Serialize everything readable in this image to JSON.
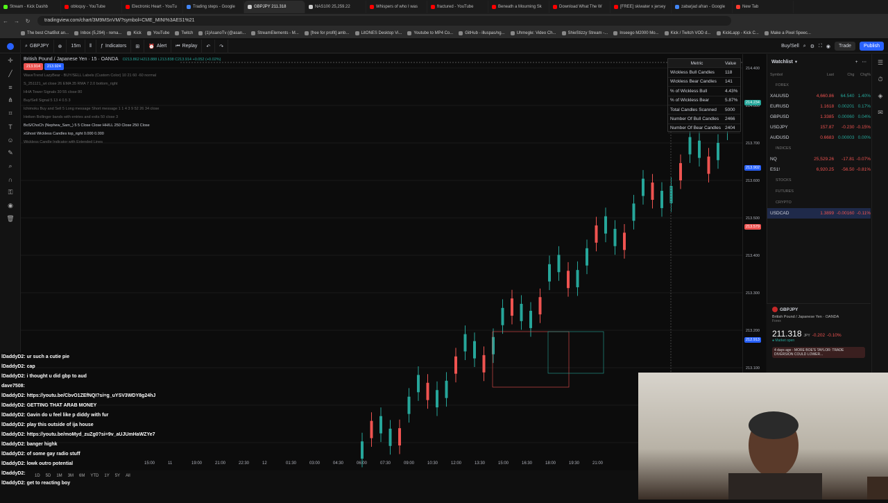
{
  "browser": {
    "tabs": [
      {
        "label": "Stream - Kick Dashb",
        "color": "#53fc18"
      },
      {
        "label": "obloquy - YouTube",
        "color": "#ff0000"
      },
      {
        "label": "Electronic Heart - YouTu",
        "color": "#ff0000"
      },
      {
        "label": "Trading steps - Google",
        "color": "#4285f4"
      },
      {
        "label": "GBPJPY 211.318",
        "color": "#cccccc"
      },
      {
        "label": "NAS100 25,259.22",
        "color": "#cccccc"
      },
      {
        "label": "Whispers of who I was",
        "color": "#ff0000"
      },
      {
        "label": "fractured - YouTube",
        "color": "#ff0000"
      },
      {
        "label": "Beneath a Mourning Sk",
        "color": "#ff0000"
      },
      {
        "label": "Download What The W",
        "color": "#ff0000"
      },
      {
        "label": "[FREE] skiwater x jersey",
        "color": "#ff0000"
      },
      {
        "label": "zabarjad afran - Google",
        "color": "#4285f4"
      },
      {
        "label": "New Tab",
        "color": "#ff3b30"
      }
    ],
    "url": "tradingview.com/chart/3M9MSnVM/?symbol=CME_MINI%3AES1%21",
    "bookmarks": [
      "The best ChatBot an...",
      "Inbox (5,294) - rema...",
      "Kick",
      "YouTube",
      "Twitch",
      "(1)AsanoTv (@asan...",
      "StreamElements - M...",
      "[free for profit] amb...",
      "LitONES Desktop Vi...",
      "Youtube to MP4 Co...",
      "GitHub - illuspas/ng...",
      "Uhmegle: Video Ch...",
      "ShieStizzy Stream -...",
      "Inseego M2000 Mo...",
      "Kick / Twitch VOD d...",
      "KickLapp - Kick C...",
      "Make a Pixel Speec..."
    ]
  },
  "toolbar": {
    "symbol": "GBPJPY",
    "interval": "15m",
    "indicators": "Indicators",
    "alert": "Alert",
    "replay": "Replay",
    "buysell": "Buy/Sell",
    "trade": "Trade",
    "publish": "Publish"
  },
  "chart": {
    "title": "British Pound / Japanese Yen · 15 · OANDA",
    "ohlc": "O213.862 H213.888 L213.838 C213.914 +0.052 (+0.02%)",
    "sell_price": "213.914",
    "buy_price": "213.924",
    "indicators": [
      "WaveTrend LazyBear - BUY/SELL Labels (Custom Color) 10 21 60 -60 normal",
      "S_251121_wt close 26 EMA 35 RMA 7 2.0 bottom_right",
      "HHA Tower Signals 30 55 close 80",
      "Buy/Sell Signal 5 13 4 0.5 3",
      "Ichimoku Buy and Sell 5 Long message Short message 1 1 4 3 9 52 26 34 close",
      "Heiken Bollinger bands with entries and exits 50 close 3",
      "BoS/ChoCh (Nephew_Sam_) 5 5 Close Close HH/LL 250 Close 250 Close",
      "xGhost Wickless Candles top_right 0.000 0.000",
      "Wickless Candle Indicator with Extended Lines"
    ],
    "price_labels": [
      "214.400",
      "214.000",
      "213.700",
      "213.600",
      "213.500",
      "213.400",
      "213.300",
      "213.200",
      "213.100",
      "213.000",
      "212.900"
    ],
    "price_tags": [
      {
        "text": "214.234",
        "color": "#26a69a"
      },
      {
        "text": "213.902",
        "color": "#2962ff"
      },
      {
        "text": "213.579",
        "color": "#ef5350"
      },
      {
        "text": "212.913",
        "color": "#2962ff"
      }
    ],
    "time_labels": [
      "15:00",
      "11",
      "19:00",
      "21:00",
      "22:30",
      "12",
      "01:30",
      "03:00",
      "04:30",
      "06:00",
      "07:30",
      "09:00",
      "10:30",
      "12:00",
      "13:30",
      "15:00",
      "16:30",
      "18:00",
      "19:30",
      "21:00"
    ],
    "ranges": [
      "1D",
      "5D",
      "1M",
      "3M",
      "6M",
      "YTD",
      "1Y",
      "5Y",
      "All"
    ]
  },
  "chart_data": {
    "type": "candlestick",
    "series": [
      {
        "name": "GBPJPY",
        "values": [
          212.78,
          212.8,
          212.82,
          212.85,
          212.9,
          212.92,
          212.95,
          212.98,
          213.0,
          213.02,
          213.05,
          213.08,
          213.1,
          213.12,
          213.15,
          213.18,
          213.2,
          213.22,
          213.25,
          213.28,
          213.3,
          213.32,
          213.35,
          213.38,
          213.4,
          213.42,
          213.45,
          213.48,
          213.5,
          213.52
        ]
      }
    ]
  },
  "metrics": {
    "header": [
      "Metric",
      "Value"
    ],
    "rows": [
      [
        "Wickless Bull Candles",
        "118"
      ],
      [
        "Wickless Bear Candles",
        "141"
      ],
      [
        "% of Wickless Bull",
        "4.43%"
      ],
      [
        "% of Wickless Bear",
        "5.87%"
      ],
      [
        "Total Candles Scanned",
        "5000"
      ],
      [
        "Number Of Bull Candles",
        "2466"
      ],
      [
        "Number Of Bear Candles",
        "2404"
      ]
    ]
  },
  "watchlist": {
    "title": "Watchlist",
    "columns": [
      "Symbol",
      "Last",
      "Chg",
      "Chg%"
    ],
    "sections": [
      {
        "name": "FOREX",
        "items": [
          {
            "sym": "XAUUSD",
            "last": "4,660.86",
            "chg": "64.540",
            "pct": "1.40%",
            "dir": "green"
          },
          {
            "sym": "EURUSD",
            "last": "1.1618",
            "chg": "0.00201",
            "pct": "0.17%",
            "dir": "green"
          },
          {
            "sym": "GBPUSD",
            "last": "1.3385",
            "chg": "0.00060",
            "pct": "0.04%",
            "dir": "green"
          },
          {
            "sym": "USDJPY",
            "last": "157.87",
            "chg": "-0.230",
            "pct": "-0.15%",
            "dir": "red"
          },
          {
            "sym": "AUDUSD",
            "last": "0.6683",
            "chg": "0.00003",
            "pct": "0.00%",
            "dir": "green"
          }
        ]
      },
      {
        "name": "INDICES",
        "items": [
          {
            "sym": "NQ",
            "last": "25,529.26",
            "chg": "-17.81",
            "pct": "-0.07%",
            "dir": "red"
          },
          {
            "sym": "ES1!",
            "last": "6,920.25",
            "chg": "-56.50",
            "pct": "-0.81%",
            "dir": "red"
          }
        ]
      },
      {
        "name": "STOCKS",
        "items": []
      },
      {
        "name": "FUTURES",
        "items": []
      },
      {
        "name": "CRYPTO",
        "items": [
          {
            "sym": "USDCAD",
            "last": "1.3899",
            "chg": "-0.00160",
            "pct": "-0.11%",
            "dir": "red"
          }
        ]
      }
    ]
  },
  "detail": {
    "symbol": "GBPJPY",
    "name": "British Pound / Japanese Yen",
    "venue": "OANDA",
    "type": "Forex",
    "price": "211.318",
    "currency": "JPY",
    "change": "-0.202",
    "change_pct": "-0.10%",
    "status": "Market open",
    "news": "4 days ago - MORE BOE'S TAYLOR: TRADE DIVERSION COULD LOWER..."
  },
  "chat": [
    {
      "user": "lDaddyD2",
      "text": "ur such a cutie pie"
    },
    {
      "user": "lDaddyD2",
      "text": "cap"
    },
    {
      "user": "lDaddyD2",
      "text": "i thought u did gbp to aud"
    },
    {
      "user": "dave7508",
      "text": ""
    },
    {
      "user": "lDaddyD2",
      "text": "https://youtu.be/CbvO1ZEfNQI?si=g_uYSV3WDY8g24hJ"
    },
    {
      "user": "lDaddyD2",
      "text": "GETTING THAT ARAB MONEY"
    },
    {
      "user": "lDaddyD2",
      "text": "Gavin do u feel like p diddy with fur"
    },
    {
      "user": "lDaddyD2",
      "text": "play this outside of ija house"
    },
    {
      "user": "lDaddyD2",
      "text": "https://youtu.be/moMyd_zuZg0?si=9v_aUJUmHaWZYe7"
    },
    {
      "user": "lDaddyD2",
      "text": "banger highk"
    },
    {
      "user": "lDaddyD2",
      "text": "of some gay radio stuff"
    },
    {
      "user": "lDaddyD2",
      "text": "lowk outro potential"
    },
    {
      "user": "lDaddyD2",
      "text": ""
    },
    {
      "user": "lDaddyD2",
      "text": "get to reacting boy"
    }
  ]
}
